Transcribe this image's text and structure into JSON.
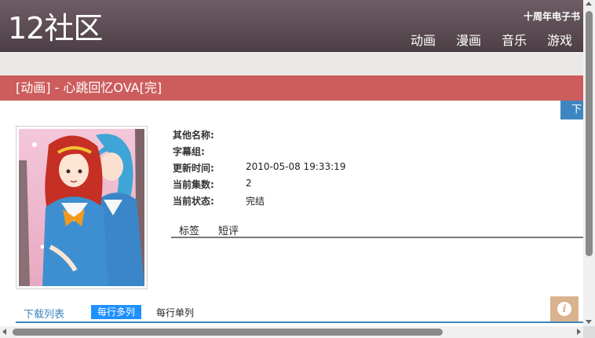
{
  "header": {
    "logo_text": "12社区",
    "ebook_link": "十周年电子书",
    "nav": [
      "动画",
      "漫画",
      "音乐",
      "游戏"
    ]
  },
  "page": {
    "title": "[动画] - 心跳回忆OVA[完]",
    "download_tab": "下"
  },
  "info": {
    "rows": [
      {
        "label": "其他名称:",
        "value": ""
      },
      {
        "label": "字幕组:",
        "value": ""
      },
      {
        "label": "更新时间:",
        "value": "2010-05-08 19:33:19"
      },
      {
        "label": "当前集数:",
        "value": "2"
      },
      {
        "label": "当前状态:",
        "value": "完结"
      }
    ],
    "tabs": [
      "标签",
      "短评"
    ]
  },
  "download_list": {
    "title": "下载列表",
    "multi_label": "每行多列",
    "single_label": "每行单列"
  },
  "colors": {
    "header_bg": "#5e4e56",
    "title_bar": "#cd5c5c",
    "accent_blue": "#3f86c0",
    "active_pill": "#1e90ff",
    "info_button": "#d8b38e"
  },
  "icons": {
    "info_button": "info-icon"
  }
}
